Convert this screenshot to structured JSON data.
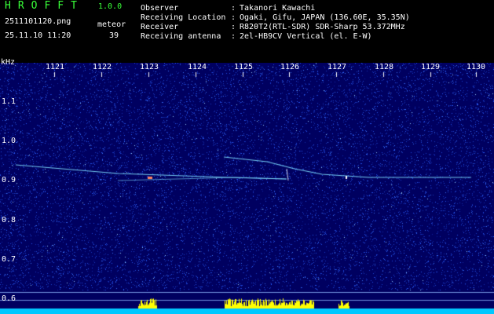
{
  "header": {
    "app_name": "HROFFT",
    "version": "1.0.0",
    "filename": "2511101120.png",
    "datetime": "25.11.10 11:20",
    "meteor_label": "meteor",
    "meteor_count": "39"
  },
  "info": [
    {
      "label": "Observer",
      "sep": ":",
      "value": "Takanori Kawachi"
    },
    {
      "label": "Receiving Location",
      "sep": ":",
      "value": "Ogaki, Gifu, JAPAN (136.60E, 35.35N)"
    },
    {
      "label": "Receiver",
      "sep": ":",
      "value": "R820T2(RTL-SDR) SDR-Sharp 53.372MHz"
    },
    {
      "label": "Receiving antenna",
      "sep": ":",
      "value": "2el-HB9CV Vertical (el. E-W)"
    }
  ],
  "spectrogram": {
    "freq_unit": "kHz",
    "time_ticks": [
      "1121",
      "1122",
      "1123",
      "1124",
      "1125",
      "1126",
      "1127",
      "1128",
      "1129",
      "1130"
    ],
    "freq_ticks": [
      "1.1",
      "1.0",
      "0.9",
      "0.8",
      "0.7",
      "0.6"
    ],
    "colors": {
      "background": "#000060",
      "noise": "#2a5fff",
      "trace": "#7fe0ff",
      "peak": "#ff8060",
      "level_bar": "#00c8ff",
      "level_peak": "#ffff00",
      "text": "#ffffff",
      "title": "#39ff39"
    }
  }
}
